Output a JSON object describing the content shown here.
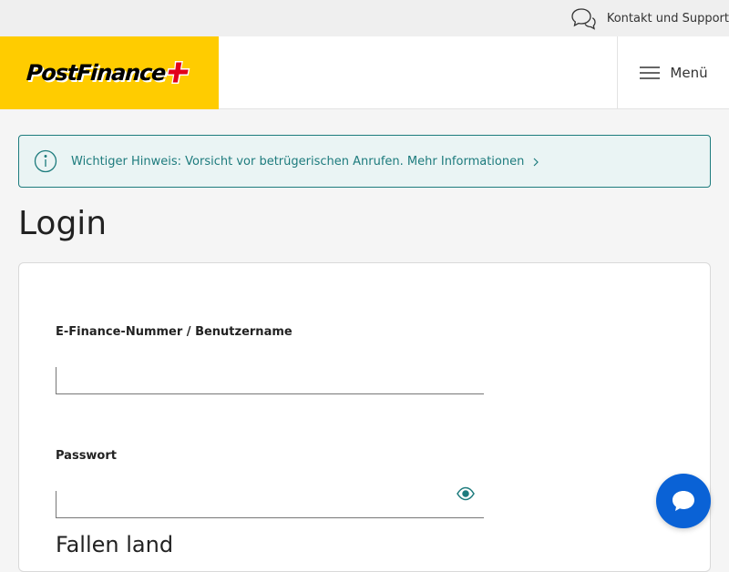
{
  "topbar": {
    "support_label": "Kontakt und Support",
    "support_icon": "chat-bubbles-icon"
  },
  "header": {
    "logo_text": "PostFinance",
    "logo_icon": "swiss-cross-icon",
    "menu_label": "Menü",
    "menu_icon": "hamburger-icon"
  },
  "notice": {
    "text": "Wichtiger Hinweis: Vorsicht vor betrügerischen Anrufen. Mehr Informationen",
    "icon": "info-icon",
    "accent": "#1d7b7d"
  },
  "page": {
    "title": "Login"
  },
  "form": {
    "username_label": "E-Finance-Nummer / Benutzername",
    "username_value": "",
    "password_label": "Passwort",
    "password_value": "",
    "forgot_text": "Fallen   land",
    "eye_icon": "eye-icon"
  },
  "chat": {
    "icon": "chat-icon",
    "color": "#0a62d6"
  },
  "colors": {
    "brand_yellow": "#ffcc00",
    "brand_red": "#e2001a",
    "teal": "#1d7b7d"
  }
}
